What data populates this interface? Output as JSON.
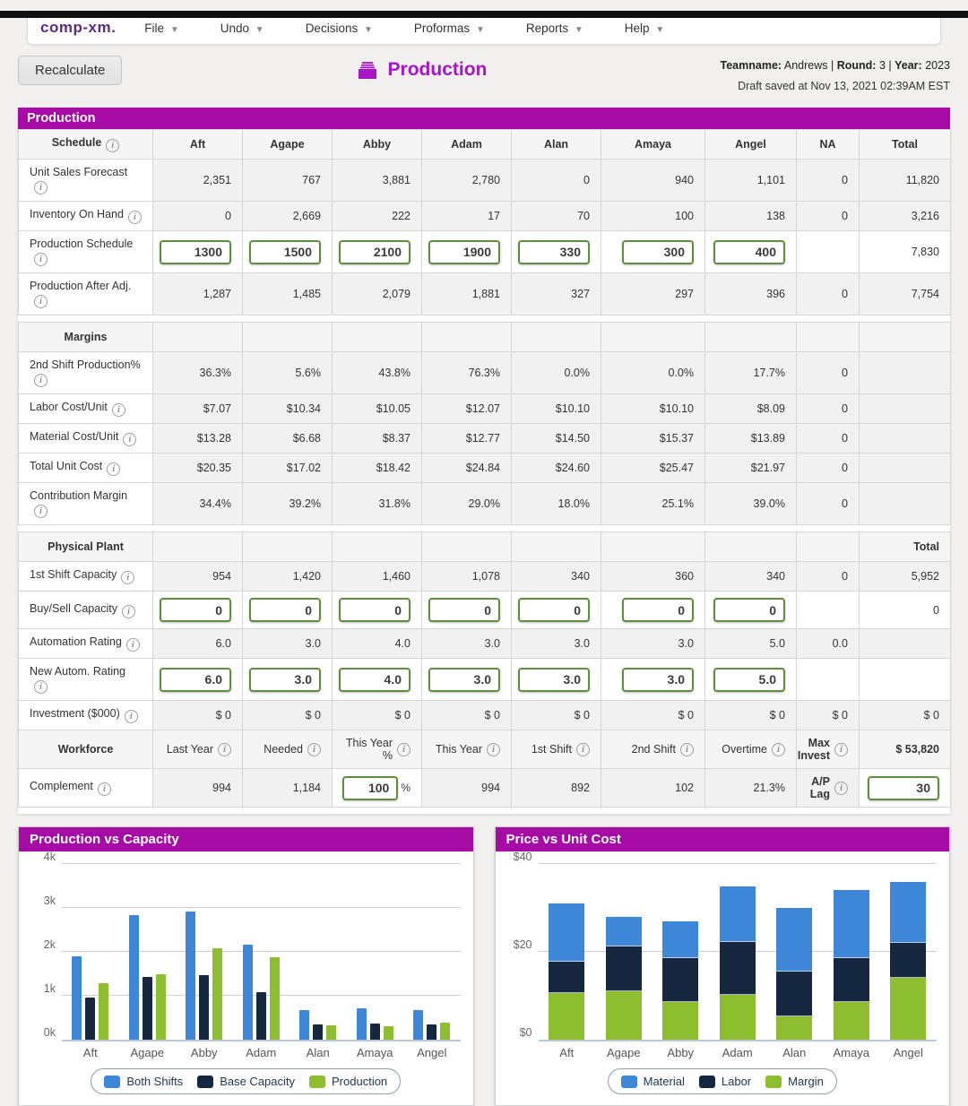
{
  "navbar": {
    "logo": "comp-xm.",
    "menus": [
      {
        "label": "File"
      },
      {
        "label": "Undo"
      },
      {
        "label": "Decisions"
      },
      {
        "label": "Proformas"
      },
      {
        "label": "Reports"
      },
      {
        "label": "Help"
      }
    ]
  },
  "header": {
    "recalculate_label": "Recalculate",
    "title": "Production",
    "teamname_label": "Teamname:",
    "teamname": "Andrews",
    "round_label": "Round:",
    "round": "3",
    "year_label": "Year:",
    "year": "2023",
    "separator": "|",
    "draft_saved": "Draft saved at Nov 13, 2021 02:39AM EST"
  },
  "band_title": "Production",
  "colors": {
    "purple_band": "#a60ba6",
    "title_purple": "#a616c6",
    "logo_purple": "#5d2b83",
    "input_border_green": "#5f8f3e",
    "chart_blue": "#3d86d8",
    "chart_navy": "#16283f",
    "chart_green": "#8cbe2f"
  },
  "schedule_table": {
    "header": [
      "Schedule",
      "Aft",
      "Agape",
      "Abby",
      "Adam",
      "Alan",
      "Amaya",
      "Angel",
      "NA",
      "Total"
    ],
    "rows": [
      {
        "label": "Unit Sales Forecast",
        "info": true,
        "type": "static",
        "values": [
          "2,351",
          "767",
          "3,881",
          "2,780",
          "0",
          "940",
          "1,101",
          "0",
          "11,820"
        ]
      },
      {
        "label": "Inventory On Hand",
        "info": true,
        "type": "static",
        "values": [
          "0",
          "2,669",
          "222",
          "17",
          "70",
          "100",
          "138",
          "0",
          "3,216"
        ]
      },
      {
        "label": "Production Schedule",
        "info": true,
        "type": "input",
        "inputs": [
          "1300",
          "1500",
          "2100",
          "1900",
          "330",
          "300",
          "400"
        ],
        "na": "",
        "total": "7,830"
      },
      {
        "label": "Production After Adj.",
        "info": true,
        "type": "static",
        "values": [
          "1,287",
          "1,485",
          "2,079",
          "1,881",
          "327",
          "297",
          "396",
          "0",
          "7,754"
        ]
      }
    ]
  },
  "margins_table": {
    "section_label": "Margins",
    "rows": [
      {
        "label": "2nd Shift Production%",
        "info": true,
        "type": "static",
        "values": [
          "36.3%",
          "5.6%",
          "43.8%",
          "76.3%",
          "0.0%",
          "0.0%",
          "17.7%",
          "0",
          ""
        ]
      },
      {
        "label": "Labor Cost/Unit",
        "info": true,
        "type": "static",
        "values": [
          "$7.07",
          "$10.34",
          "$10.05",
          "$12.07",
          "$10.10",
          "$10.10",
          "$8.09",
          "0",
          ""
        ]
      },
      {
        "label": "Material Cost/Unit",
        "info": true,
        "type": "static",
        "values": [
          "$13.28",
          "$6.68",
          "$8.37",
          "$12.77",
          "$14.50",
          "$15.37",
          "$13.89",
          "0",
          ""
        ]
      },
      {
        "label": "Total Unit Cost",
        "info": true,
        "type": "static",
        "values": [
          "$20.35",
          "$17.02",
          "$18.42",
          "$24.84",
          "$24.60",
          "$25.47",
          "$21.97",
          "0",
          ""
        ]
      },
      {
        "label": "Contribution Margin",
        "info": true,
        "type": "static",
        "values": [
          "34.4%",
          "39.2%",
          "31.8%",
          "29.0%",
          "18.0%",
          "25.1%",
          "39.0%",
          "0",
          ""
        ]
      }
    ]
  },
  "plant_table": {
    "section_label": "Physical Plant",
    "total_label": "Total",
    "rows": [
      {
        "label": "1st Shift Capacity",
        "info": true,
        "type": "static",
        "values": [
          "954",
          "1,420",
          "1,460",
          "1,078",
          "340",
          "360",
          "340",
          "0",
          "5,952"
        ]
      },
      {
        "label": "Buy/Sell Capacity",
        "info": true,
        "type": "input",
        "inputs": [
          "0",
          "0",
          "0",
          "0",
          "0",
          "0",
          "0"
        ],
        "na": "",
        "total": "0"
      },
      {
        "label": "Automation Rating",
        "info": true,
        "type": "static",
        "values": [
          "6.0",
          "3.0",
          "4.0",
          "3.0",
          "3.0",
          "3.0",
          "5.0",
          "0.0",
          ""
        ]
      },
      {
        "label": "New Autom. Rating",
        "info": true,
        "type": "input",
        "inputs": [
          "6.0",
          "3.0",
          "4.0",
          "3.0",
          "3.0",
          "3.0",
          "5.0"
        ],
        "na": "",
        "total": ""
      },
      {
        "label": "Investment ($000)",
        "info": true,
        "type": "static",
        "values": [
          "$ 0",
          "$ 0",
          "$ 0",
          "$ 0",
          "$ 0",
          "$ 0",
          "$ 0",
          "$ 0",
          "$ 0"
        ]
      }
    ]
  },
  "workforce": {
    "section_label": "Workforce",
    "header_cells": [
      {
        "label": "Last Year",
        "info": true
      },
      {
        "label": "Needed",
        "info": true
      },
      {
        "label": "This Year %",
        "info": true
      },
      {
        "label": "This Year",
        "info": true
      },
      {
        "label": "1st Shift",
        "info": true
      },
      {
        "label": "2nd Shift",
        "info": true
      },
      {
        "label": "Overtime",
        "info": true
      },
      {
        "label": "Max Invest",
        "info": true,
        "bold": true
      }
    ],
    "max_invest_value": "$ 53,820",
    "complement": {
      "label": "Complement",
      "info": true,
      "last_year": "994",
      "needed": "1,184",
      "this_year_pct_input": "100",
      "pct_suffix": "%",
      "this_year": "994",
      "first_shift": "892",
      "second_shift": "102",
      "overtime": "21.3%",
      "ap_lag_label": "A/P Lag",
      "ap_lag_input": "30"
    }
  },
  "chart_data": [
    {
      "type": "bar",
      "title": "Production vs Capacity",
      "categories": [
        "Aft",
        "Agape",
        "Abby",
        "Adam",
        "Alan",
        "Amaya",
        "Angel"
      ],
      "series": [
        {
          "name": "Both Shifts",
          "color": "#3d86d8",
          "values": [
            1908,
            2840,
            2920,
            2156,
            680,
            720,
            680
          ]
        },
        {
          "name": "Base Capacity",
          "color": "#16283f",
          "values": [
            954,
            1420,
            1460,
            1078,
            340,
            360,
            340
          ]
        },
        {
          "name": "Production",
          "color": "#8cbe2f",
          "values": [
            1287,
            1485,
            2079,
            1881,
            327,
            297,
            396
          ]
        }
      ],
      "ylim": [
        0,
        4000
      ],
      "yticks": [
        {
          "label": "4k",
          "value": 4000
        },
        {
          "label": "3k",
          "value": 3000
        },
        {
          "label": "2k",
          "value": 2000
        },
        {
          "label": "1k",
          "value": 1000
        },
        {
          "label": "0k",
          "value": 0
        }
      ],
      "grid": true,
      "legend_position": "bottom"
    },
    {
      "type": "stacked-bar",
      "title": "Price vs Unit Cost",
      "categories": [
        "Aft",
        "Agape",
        "Abby",
        "Adam",
        "Alan",
        "Amaya",
        "Angel"
      ],
      "legend_order": [
        "Material",
        "Labor",
        "Margin"
      ],
      "stack_bottom_to_top": [
        "Margin",
        "Labor",
        "Material"
      ],
      "series": [
        {
          "name": "Material",
          "color": "#3d86d8",
          "values": [
            13.28,
            6.68,
            8.37,
            12.77,
            14.5,
            15.37,
            13.89
          ]
        },
        {
          "name": "Labor",
          "color": "#16283f",
          "values": [
            7.07,
            10.34,
            10.05,
            12.07,
            10.1,
            10.1,
            8.09
          ]
        },
        {
          "name": "Margin",
          "color": "#8cbe2f",
          "values": [
            10.65,
            10.98,
            8.58,
            10.16,
            5.4,
            8.53,
            14.03
          ]
        }
      ],
      "bar_totals_price": [
        31,
        28,
        27,
        35,
        30,
        34,
        36
      ],
      "ylim": [
        0,
        40
      ],
      "yticks": [
        {
          "label": "$40",
          "value": 40
        },
        {
          "label": "$20",
          "value": 20
        },
        {
          "label": "$0",
          "value": 0
        }
      ],
      "grid": true,
      "legend_position": "bottom"
    }
  ]
}
